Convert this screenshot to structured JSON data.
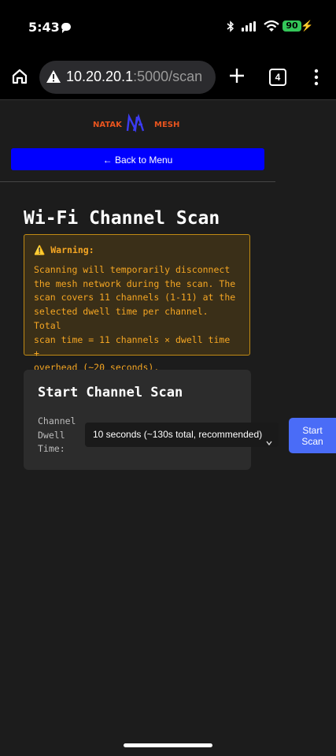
{
  "status_bar": {
    "time": "5:43",
    "battery": "90",
    "icons": [
      "chat-bubble-icon",
      "bluetooth-icon",
      "cellular-signal-icon",
      "wifi-icon",
      "battery-icon",
      "charging-bolt-icon"
    ]
  },
  "browser": {
    "url_host": "10.20.20.1",
    "url_rest": ":5000/scan",
    "tab_count": "4",
    "icons": [
      "home-icon",
      "not-secure-warning-icon",
      "new-tab-plus-icon",
      "tab-switcher-icon",
      "overflow-menu-icon"
    ]
  },
  "header": {
    "logo_left": "NATAK",
    "logo_right": "MESH",
    "logo_colors": {
      "text": "#e8541e",
      "mark": "#3b3bf0"
    },
    "back_button": "← Back to Menu"
  },
  "main": {
    "title": "Wi-Fi Channel Scan",
    "warning": {
      "heading": "⚠️ Warning:",
      "lines": [
        "Scanning will temporarily disconnect",
        "the mesh network during the scan. The",
        "scan covers 11 channels (1-11) at the",
        "selected dwell time per channel. Total",
        "scan time = 11 channels × dwell time +",
        "overhead (~20 seconds)."
      ]
    },
    "scan_card": {
      "title": "Start Channel Scan",
      "dwell_label": [
        "Channel",
        "Dwell",
        "Time:"
      ],
      "dwell_selected": "10 seconds (~130s total, recommended)",
      "start_button": [
        "Start",
        "Scan"
      ]
    }
  },
  "colors": {
    "background": "#1c1c1c",
    "back_button": "#0000ff",
    "start_button": "#4a6cf7",
    "warning_text": "#f5a623",
    "warning_border": "#c08a14"
  }
}
